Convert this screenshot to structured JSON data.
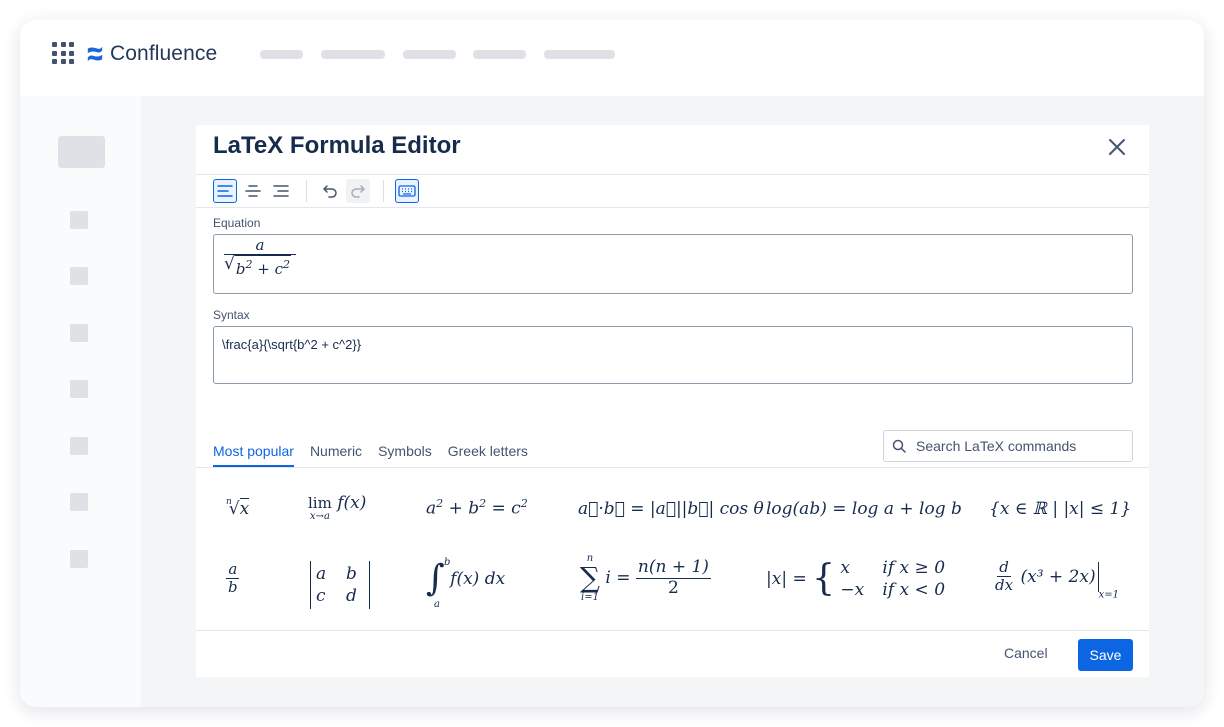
{
  "app": {
    "name": "Confluence",
    "brand_color": "#1868db"
  },
  "dialog": {
    "title": "LaTeX Formula Editor",
    "toolbar": {
      "icons": [
        "align-left-icon",
        "align-center-icon",
        "align-right-icon",
        "undo-icon",
        "redo-icon",
        "keyboard-icon"
      ],
      "active": "align-left",
      "disabled": [
        "redo"
      ]
    },
    "equation": {
      "label": "Equation",
      "preview": {
        "numerator": "a",
        "radicand_b": "b",
        "exp1": "2",
        "plus": "+",
        "radicand_c": "c",
        "exp2": "2"
      }
    },
    "syntax": {
      "label": "Syntax",
      "value": "\\frac{a}{\\sqrt{b^2 + c^2}}"
    },
    "tabs": [
      "Most popular",
      "Numeric",
      "Symbols",
      "Greek letters"
    ],
    "active_tab": "Most popular",
    "search": {
      "placeholder": "Search LaTeX commands"
    },
    "formulas": {
      "nth_root": {
        "index": "n",
        "radicand": "x"
      },
      "limit": {
        "op": "lim",
        "sub": "x→a",
        "expr": "f(x)"
      },
      "pythagoras": {
        "lhs_a": "a",
        "lhs_b": "b",
        "rhs_c": "c",
        "exp": "2"
      },
      "dot_product": {
        "expr": "a⃗·b⃗ = |a⃗||b⃗| cos θ"
      },
      "log_rule": {
        "expr": "log(ab) = log a + log b"
      },
      "set": {
        "expr": "{x ∈ ℝ | |x| ≤ 1}"
      },
      "fraction": {
        "num": "a",
        "den": "b"
      },
      "matrix": {
        "cells": [
          "a",
          "b",
          "c",
          "d"
        ]
      },
      "integral": {
        "upper": "b",
        "lower": "a",
        "expr": "f(x) dx"
      },
      "sum": {
        "upper": "n",
        "lower": "i=1",
        "var": "i",
        "num": "n(n + 1)",
        "den": "2"
      },
      "abs_piecewise": {
        "lhs": "|x| =",
        "case1_val": "x",
        "case1_cond": "if x ≥ 0",
        "case2_val": "−x",
        "case2_cond": "if x < 0"
      },
      "derivative": {
        "num": "d",
        "den": "dx",
        "expr": "(x³ + 2x)",
        "eval": "x=1"
      }
    },
    "footer": {
      "cancel": "Cancel",
      "save": "Save"
    },
    "accent_color": "#0c66e4"
  }
}
